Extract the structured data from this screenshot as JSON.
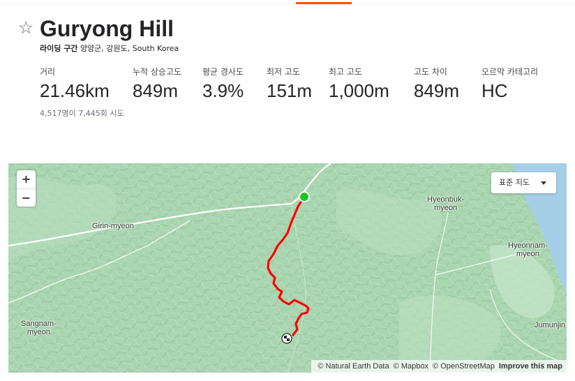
{
  "segment": {
    "title": "Guryong Hill",
    "type_label": "라이딩 구간",
    "location": "양양군, 강원도, South Korea",
    "favorite_icon": "star-outline-icon",
    "attempts": "4,517명이 7,445회 시도"
  },
  "stats": [
    {
      "label": "거리",
      "value": "21.46km"
    },
    {
      "label": "누적 상승고도",
      "value": "849m"
    },
    {
      "label": "평균 경사도",
      "value": "3.9%"
    },
    {
      "label": "최저 고도",
      "value": "151m"
    },
    {
      "label": "최고 고도",
      "value": "1,000m"
    },
    {
      "label": "고도 차이",
      "value": "849m"
    },
    {
      "label": "오르막 카테고리",
      "value": "HC"
    }
  ],
  "map": {
    "zoom_in": "+",
    "zoom_out": "−",
    "style_selector": "표준 지도",
    "places": {
      "girin": "Girin-myeon",
      "hyeonbuk": "Hyeonbuk-\nmyeon",
      "hyeonnam": "Hyeonnam-\nmyeon",
      "sangnam": "Sangnam-\nmyeon",
      "jumunjin": "Jumunjin"
    },
    "attribution": {
      "natural_earth": "© Natural Earth Data",
      "mapbox": "© Mapbox",
      "osm": "© OpenStreetMap",
      "improve": "Improve this map"
    },
    "colors": {
      "route": "#ff0000",
      "start_marker": "#1ec41e",
      "terrain": "#a9d5b0",
      "water": "#a6cfe7",
      "road": "#ffffff"
    }
  }
}
